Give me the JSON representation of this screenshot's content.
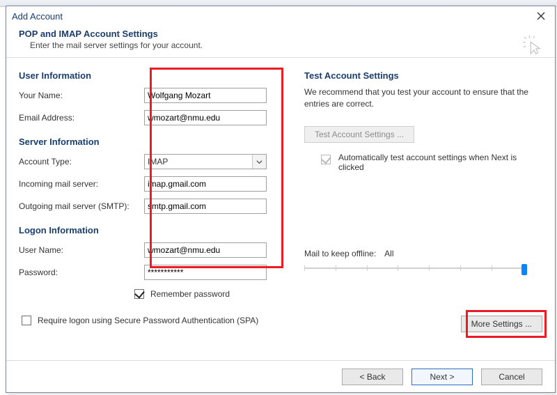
{
  "dialog": {
    "title": "Add Account",
    "heading": "POP and IMAP Account Settings",
    "subheading": "Enter the mail server settings for your account."
  },
  "left": {
    "userInfoTitle": "User Information",
    "yourNameLabel": "Your Name:",
    "yourNameValue": "Wolfgang Mozart",
    "emailLabel": "Email Address:",
    "emailValue": "wmozart@nmu.edu",
    "serverInfoTitle": "Server Information",
    "accountTypeLabel": "Account Type:",
    "accountTypeValue": "IMAP",
    "incomingLabel": "Incoming mail server:",
    "incomingValue": "imap.gmail.com",
    "outgoingLabel": "Outgoing mail server (SMTP):",
    "outgoingValue": "smtp.gmail.com",
    "logonInfoTitle": "Logon Information",
    "userNameLabel": "User Name:",
    "userNameValue": "wmozart@nmu.edu",
    "passwordLabel": "Password:",
    "passwordValue": "***********",
    "rememberLabel": "Remember password",
    "spaLabel": "Require logon using Secure Password Authentication (SPA)"
  },
  "right": {
    "title": "Test Account Settings",
    "description": "We recommend that you test your account to ensure that the entries are correct.",
    "testButton": "Test Account Settings ...",
    "autoTestLabel": "Automatically test account settings when Next is clicked",
    "mailKeepLabel": "Mail to keep offline:",
    "mailKeepValue": "All",
    "moreSettings": "More Settings ..."
  },
  "footer": {
    "back": "< Back",
    "next": "Next >",
    "cancel": "Cancel"
  }
}
